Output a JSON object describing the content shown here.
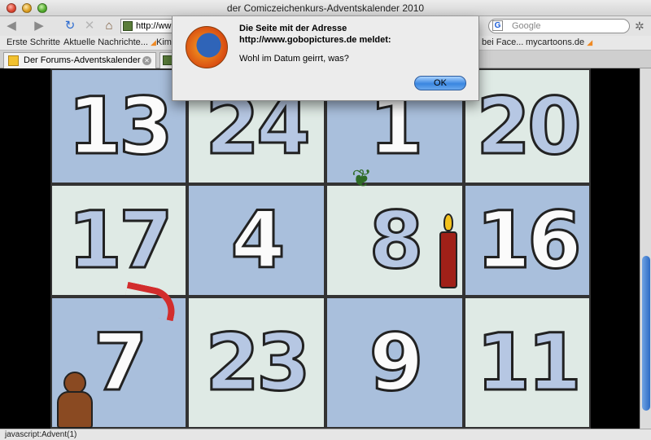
{
  "window": {
    "title": "der Comiczeichenkurs-Adventskalender 2010"
  },
  "toolbar": {
    "url_value": "http://ww",
    "search_placeholder": "Google",
    "search_engine_letter": "G"
  },
  "bookmarks": [
    {
      "label": "Erste Schritte",
      "rss": false
    },
    {
      "label": "Aktuelle Nachrichte...",
      "rss": true
    },
    {
      "label": "Kim",
      "rss": false
    },
    {
      "label": "bei Face...",
      "rss": false
    },
    {
      "label": "mycartoons.de",
      "rss": true
    }
  ],
  "tabs": [
    {
      "label": "Der Forums-Adventskalender ..."
    }
  ],
  "calendar": {
    "days": [
      "13",
      "24",
      "1",
      "20",
      "17",
      "4",
      "8",
      "16",
      "7",
      "23",
      "9",
      "11"
    ]
  },
  "dialog": {
    "title_line1": "Die Seite mit der Adresse",
    "title_line2": "http://www.gobopictures.de meldet:",
    "message": "Wohl im Datum geirrt, was?",
    "ok_label": "OK"
  },
  "statusbar": {
    "text": "javascript:Advent(1)"
  }
}
